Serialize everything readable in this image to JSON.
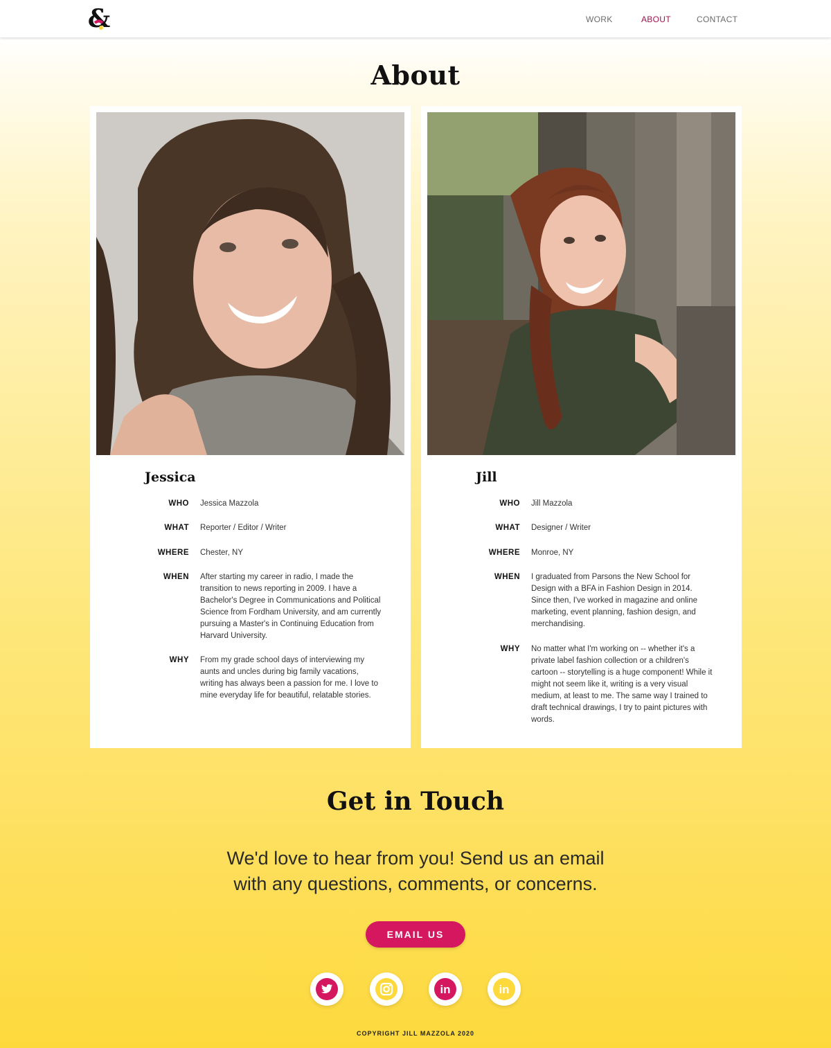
{
  "nav": {
    "logo": "&",
    "items": [
      {
        "label": "WORK",
        "active": false
      },
      {
        "label": "ABOUT",
        "active": true
      },
      {
        "label": "CONTACT",
        "active": false
      }
    ]
  },
  "page_title": "About",
  "profiles": [
    {
      "name": "Jessica",
      "photo_icon": "jessica-portrait-photo",
      "who_label": "WHO",
      "who": "Jessica Mazzola",
      "what_label": "WHAT",
      "what": "Reporter / Editor / Writer",
      "where_label": "WHERE",
      "where": "Chester, NY",
      "when_label": "WHEN",
      "when": "After starting my career in radio, I made the transition to news reporting in 2009. I have a Bachelor's Degree in Communications and Political Science from Fordham University, and am currently pursuing a Master's in Continuing Education from Harvard University.",
      "why_label": "WHY",
      "why": "From my grade school days of interviewing my aunts and uncles during big family vacations, writing has always been a passion for me. I love to mine everyday life for beautiful, relatable stories."
    },
    {
      "name": "Jill",
      "photo_icon": "jill-portrait-photo",
      "who_label": "WHO",
      "who": "Jill  Mazzola",
      "what_label": "WHAT",
      "what": "Designer / Writer",
      "where_label": "WHERE",
      "where": "Monroe, NY",
      "when_label": "WHEN",
      "when": "I graduated from Parsons the New School for  Design with a BFA in Fashion Design in 2014. Since then, I've worked in magazine and online marketing, event planning, fashion design, and merchandising.",
      "why_label": "WHY",
      "why": "No matter what I'm working on -- whether it's a private label fashion collection or a children's cartoon -- storytelling is a huge component! While it might not seem like it, writing is a very visual medium, at least to me. The same way I trained to draft technical drawings, I try to paint pictures with words."
    }
  ],
  "contact": {
    "title": "Get in Touch",
    "text": "We'd love to hear from you! Send us an email with any questions, comments, or concerns.",
    "button": "EMAIL US"
  },
  "social": [
    {
      "icon": "twitter-icon",
      "color": "#d4175e",
      "style": "filled"
    },
    {
      "icon": "instagram-icon",
      "color": "#fdd93c",
      "style": "filled"
    },
    {
      "icon": "linkedin-icon",
      "color": "#d4175e",
      "style": "filled",
      "label": "in"
    },
    {
      "icon": "linkedin-icon",
      "color": "#fdd93c",
      "style": "filled",
      "label": "in"
    }
  ],
  "copyright": "COPYRIGHT JILL MAZZOLA 2020",
  "colors": {
    "accent": "#d4175e",
    "nav_active": "#a0124d",
    "yellow": "#fdd93c"
  }
}
